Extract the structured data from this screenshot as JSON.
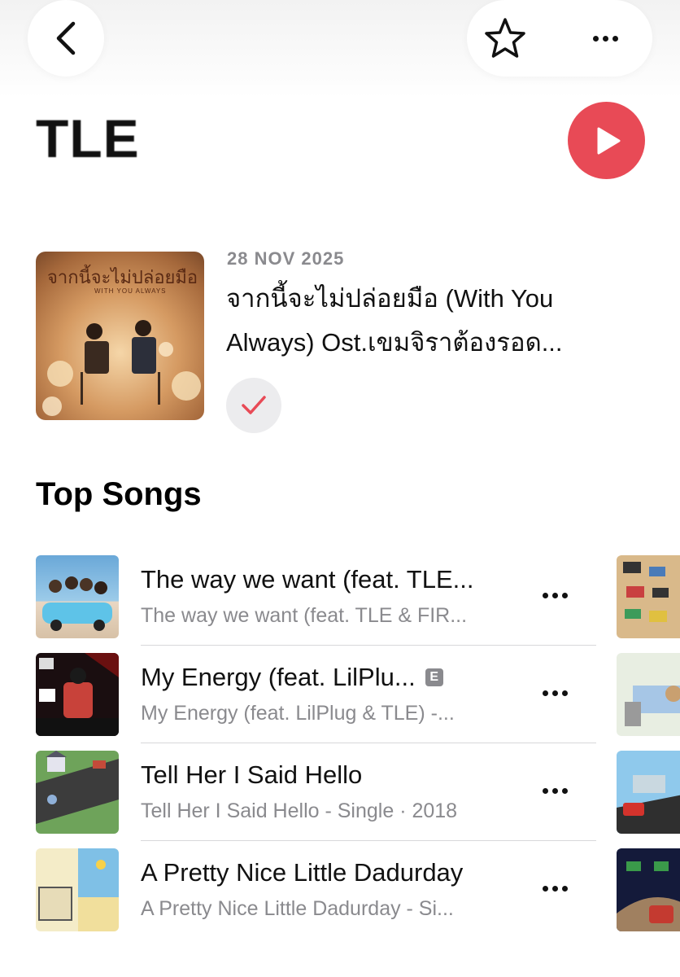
{
  "header": {
    "back_icon": "chevron-left-icon",
    "favorite_icon": "star-icon",
    "more_icon": "ellipsis-icon"
  },
  "artist": {
    "name": "TLE",
    "play_icon": "play-icon",
    "accent_color": "#e84a56"
  },
  "latest_release": {
    "date": "28 NOV 2025",
    "title": "จากนี้จะไม่ปล่อยมือ (With You Always) Ost.เขมจิราต้องรอด...",
    "added_icon": "checkmark-icon",
    "artwork_text": "จากนี้จะไม่ปล่อยมือ",
    "artwork_subtext": "WITH YOU ALWAYS"
  },
  "top_songs": {
    "title": "Top Songs",
    "items": [
      {
        "title": "The way we want (feat. TLE...",
        "subtitle": "The way we want (feat. TLE & FIR...",
        "explicit": false,
        "more_icon": "ellipsis-icon"
      },
      {
        "title": "My Energy (feat. LilPlu...",
        "subtitle": "My Energy (feat. LilPlug & TLE) -...",
        "explicit": true,
        "explicit_label": "E",
        "more_icon": "ellipsis-icon"
      },
      {
        "title": "Tell Her I Said Hello",
        "subtitle": "Tell Her I Said Hello - Single · 2018",
        "explicit": false,
        "more_icon": "ellipsis-icon"
      },
      {
        "title": "A Pretty Nice Little Dadurday",
        "subtitle": "A Pretty Nice Little Dadurday - Si...",
        "explicit": false,
        "more_icon": "ellipsis-icon"
      }
    ]
  }
}
